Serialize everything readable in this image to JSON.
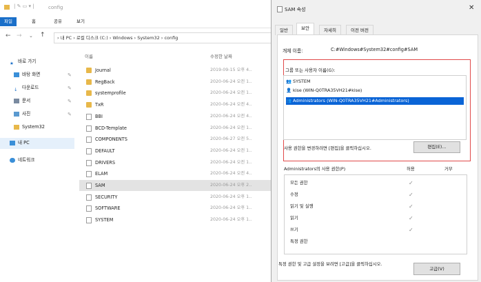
{
  "explorer": {
    "window_title": "config",
    "ribbon_tabs": [
      "파일",
      "홈",
      "공유",
      "보기"
    ],
    "breadcrumb": "› 내 PC  ›  로컬 디스크 (C:)  ›  Windows  ›  System32  ›  config",
    "nav_items": [
      {
        "label": "바로 가기",
        "icon": "star-icon"
      },
      {
        "label": "바탕 화면",
        "icon": "desktop-icon"
      },
      {
        "label": "다운로드",
        "icon": "download-icon"
      },
      {
        "label": "문서",
        "icon": "documents-icon"
      },
      {
        "label": "사진",
        "icon": "pictures-icon"
      },
      {
        "label": "System32",
        "icon": "folder-icon"
      },
      {
        "label": "내 PC",
        "icon": "pc-icon"
      },
      {
        "label": "네트워크",
        "icon": "network-icon"
      }
    ],
    "columns": {
      "name": "이름",
      "date": "수정한 날짜"
    },
    "files": [
      {
        "name": "Journal",
        "date": "2019-09-15 오후 4..",
        "type": "folder"
      },
      {
        "name": "RegBack",
        "date": "2020-06-24 오전 1..",
        "type": "folder"
      },
      {
        "name": "systemprofile",
        "date": "2020-06-24 오전 1..",
        "type": "folder"
      },
      {
        "name": "TxR",
        "date": "2020-06-24 오전 4..",
        "type": "folder"
      },
      {
        "name": "BBI",
        "date": "2020-06-24 오전 4..",
        "type": "file"
      },
      {
        "name": "BCD-Template",
        "date": "2020-06-24 오전 1..",
        "type": "file"
      },
      {
        "name": "COMPONENTS",
        "date": "2020-06-27 오전 5..",
        "type": "file"
      },
      {
        "name": "DEFAULT",
        "date": "2020-06-24 오전 1..",
        "type": "file"
      },
      {
        "name": "DRIVERS",
        "date": "2020-06-24 오전 1..",
        "type": "file"
      },
      {
        "name": "ELAM",
        "date": "2020-06-24 오전 4..",
        "type": "file"
      },
      {
        "name": "SAM",
        "date": "2020-06-24 오후 2..",
        "type": "file"
      },
      {
        "name": "SECURITY",
        "date": "2020-06-24 오후 1..",
        "type": "file"
      },
      {
        "name": "SOFTWARE",
        "date": "2020-06-24 오후 1..",
        "type": "file"
      },
      {
        "name": "SYSTEM",
        "date": "2020-06-24 오후 1..",
        "type": "file"
      }
    ]
  },
  "dialog": {
    "title": "SAM 속성",
    "tabs": [
      "일반",
      "보안",
      "자세히",
      "이전 버전"
    ],
    "object_name_label": "개체 이름:",
    "object_name_value": "C:#Windows#System32#config#SAM",
    "group_label": "그룹 또는 사용자 이름(G):",
    "users": [
      {
        "label": "SYSTEM"
      },
      {
        "label": "kise (WIN-Q0TRA35VH21#kise)"
      },
      {
        "label": "Administrators (WIN-Q0TRA35VH21#Administrators)"
      }
    ],
    "change_text": "사용 권한을 변경하려면 [편집]을 클릭하십시오.",
    "edit_button": "편집(E)...",
    "perm_label": "Administrators의 사용 권한(P)",
    "allow_label": "허용",
    "deny_label": "거부",
    "permissions": [
      {
        "label": "모든 권한",
        "allow": true
      },
      {
        "label": "수정",
        "allow": true
      },
      {
        "label": "읽기 및 실행",
        "allow": true
      },
      {
        "label": "읽기",
        "allow": true
      },
      {
        "label": "쓰기",
        "allow": true
      },
      {
        "label": "특정 권한",
        "allow": false
      }
    ],
    "advanced_text": "특정 권한 및 고급 설정을 보려면 [고급]을 클릭하십시오.",
    "advanced_button": "고급(V)",
    "accent_color": "#0a64d6",
    "highlight_color": "#e04848"
  }
}
